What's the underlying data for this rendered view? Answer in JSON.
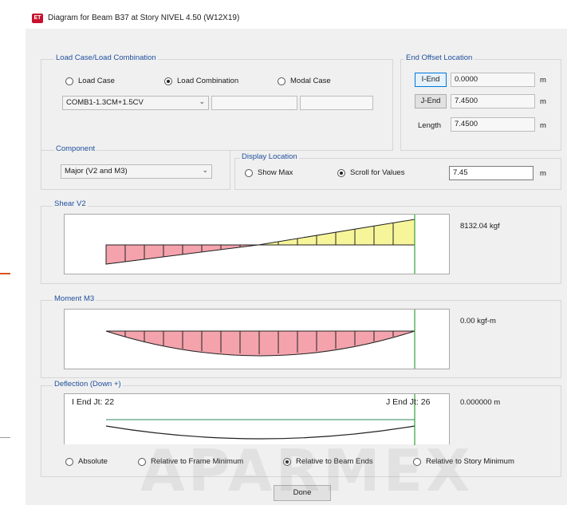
{
  "window": {
    "title": "Diagram for Beam B37 at Story NIVEL 4.50 (W12X19)",
    "app_icon": "ET"
  },
  "load_case_group": {
    "label": "Load Case/Load Combination",
    "options": [
      "Load Case",
      "Load Combination",
      "Modal Case"
    ],
    "selected": "Load Combination",
    "combo_value": "COMB1-1.3CM+1.5CV"
  },
  "end_offset": {
    "label": "End Offset Location",
    "i_end_label": "I-End",
    "i_end_value": "0.0000",
    "j_end_label": "J-End",
    "j_end_value": "7.4500",
    "length_label": "Length",
    "length_value": "7.4500",
    "unit": "m"
  },
  "component": {
    "label": "Component",
    "value": "Major (V2 and M3)"
  },
  "display_location": {
    "label": "Display Location",
    "show_max": "Show Max",
    "scroll": "Scroll for Values",
    "value": "7.45",
    "unit": "m"
  },
  "shear": {
    "label": "Shear V2",
    "readout": "8132.04 kgf"
  },
  "moment": {
    "label": "Moment M3",
    "readout": "0.00 kgf-m"
  },
  "deflection": {
    "label": "Deflection (Down +)",
    "i_end_text": "I End Jt: 22",
    "j_end_text": "J End Jt: 26",
    "readout": "0.000000 m"
  },
  "deflection_options": {
    "items": [
      "Absolute",
      "Relative to Frame Minimum",
      "Relative to Beam Ends",
      "Relative to Story Minimum"
    ],
    "selected": "Relative to Beam Ends"
  },
  "done_label": "Done",
  "watermark": "APARMEX",
  "colors": {
    "negative_fill": "#f4a3ac",
    "positive_fill": "#f6f59a",
    "cursor_line": "#35a035",
    "group_label": "#1f4e9c"
  }
}
